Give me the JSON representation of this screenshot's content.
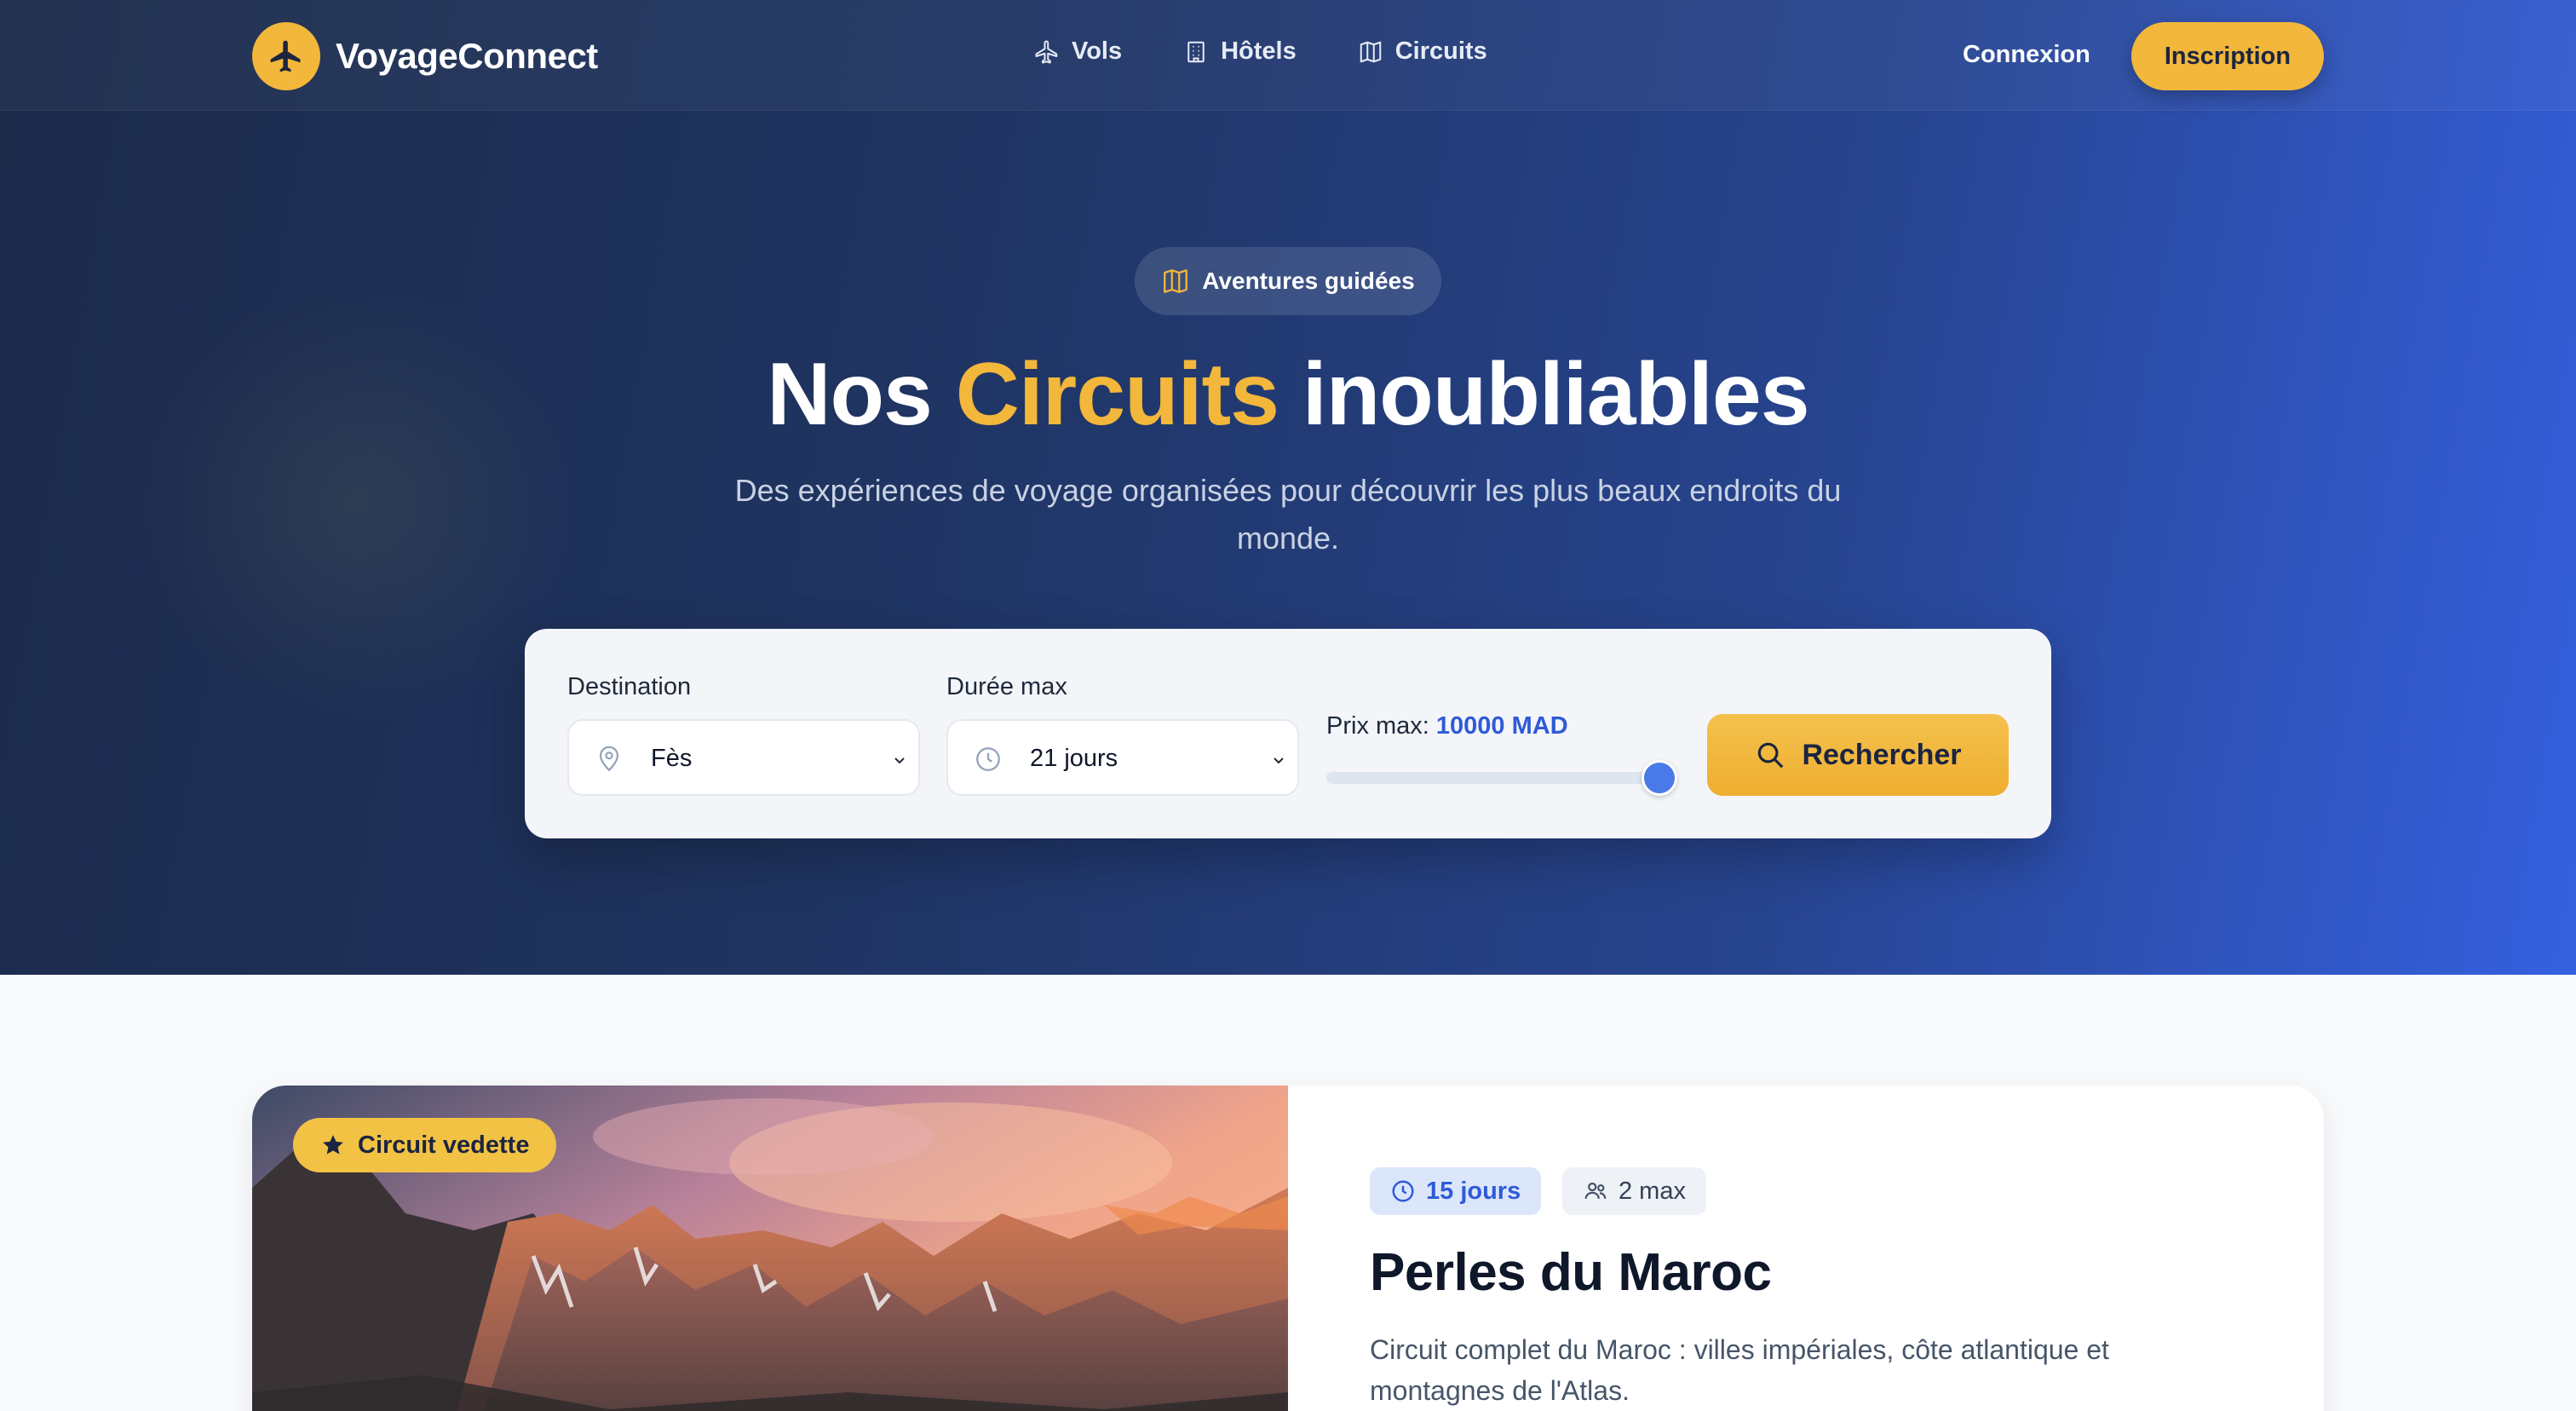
{
  "brand": {
    "name": "VoyageConnect"
  },
  "nav": {
    "items": [
      {
        "label": "Vols",
        "icon": "plane-icon"
      },
      {
        "label": "Hôtels",
        "icon": "building-icon"
      },
      {
        "label": "Circuits",
        "icon": "map-icon"
      }
    ],
    "login": "Connexion",
    "signup": "Inscription"
  },
  "hero": {
    "pill": "Aventures guidées",
    "title_before": "Nos ",
    "title_accent": "Circuits",
    "title_after": " inoubliables",
    "subtitle": "Des expériences de voyage organisées pour découvrir les plus beaux endroits du monde."
  },
  "search": {
    "destination_label": "Destination",
    "destination_value": "Fès",
    "duration_label": "Durée max",
    "duration_value": "21 jours",
    "price_label": "Prix max: ",
    "price_value": "10000 MAD",
    "price_fraction": 1.0,
    "button": "Rechercher"
  },
  "featured": {
    "badge": "Circuit vedette",
    "duration": "15 jours",
    "people": "2 max",
    "title": "Perles du Maroc",
    "description": "Circuit complet du Maroc : villes impériales, côte atlantique et montagnes de l'Atlas."
  },
  "colors": {
    "accent": "#f2b73b",
    "primary": "#2f5bd8",
    "hero_dark": "#1c2a4a",
    "hero_blue": "#3560e0"
  }
}
